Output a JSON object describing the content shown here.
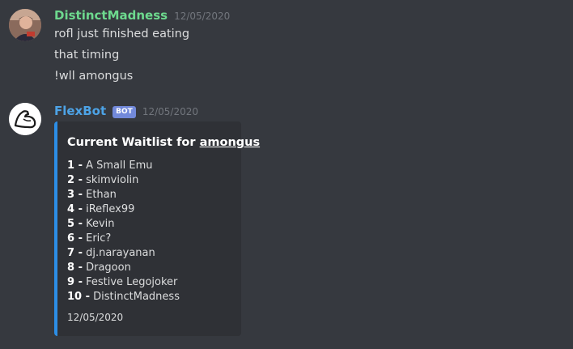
{
  "messages": [
    {
      "username": "DistinctMadness",
      "timestamp": "12/05/2020",
      "username_color": "#6dd98e",
      "lines": [
        "rofl just finished eating",
        "that timing",
        "!wll amongus"
      ]
    },
    {
      "username": "FlexBot",
      "bot_tag": "BOT",
      "timestamp": "12/05/2020",
      "username_color": "#4da3e6",
      "embed": {
        "title_prefix": "Current Waitlist for ",
        "title_link": "amongus",
        "accent_color": "#2c8ee6",
        "waitlist": [
          {
            "rank": "1 -",
            "name": "A Small Emu"
          },
          {
            "rank": "2 -",
            "name": "skimviolin"
          },
          {
            "rank": "3 -",
            "name": "Ethan"
          },
          {
            "rank": "4 -",
            "name": "iReflex99"
          },
          {
            "rank": "5 -",
            "name": "Kevin"
          },
          {
            "rank": "6 -",
            "name": "Eric?"
          },
          {
            "rank": "7 -",
            "name": "dj.narayanan"
          },
          {
            "rank": "8 -",
            "name": "Dragoon"
          },
          {
            "rank": "9 -",
            "name": "Festive Legojoker"
          },
          {
            "rank": "10 -",
            "name": "DistinctMadness"
          }
        ],
        "footer": "12/05/2020"
      }
    }
  ]
}
